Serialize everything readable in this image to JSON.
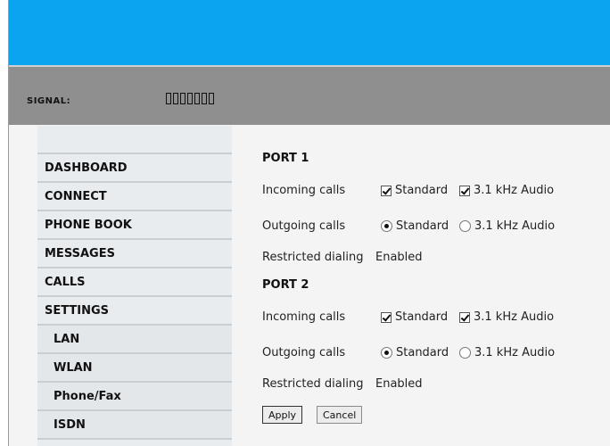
{
  "header": {
    "signal_label": "SIGNAL:",
    "signal_bars_total": 7,
    "signal_bars_filled": 0
  },
  "nav": {
    "items": [
      {
        "label": "DASHBOARD",
        "sub": false
      },
      {
        "label": "CONNECT",
        "sub": false
      },
      {
        "label": "PHONE BOOK",
        "sub": false
      },
      {
        "label": "MESSAGES",
        "sub": false
      },
      {
        "label": "CALLS",
        "sub": false
      },
      {
        "label": "SETTINGS",
        "sub": false
      },
      {
        "label": "LAN",
        "sub": true
      },
      {
        "label": "WLAN",
        "sub": true
      },
      {
        "label": "Phone/Fax",
        "sub": true
      },
      {
        "label": "ISDN",
        "sub": true
      }
    ]
  },
  "port1": {
    "title": "PORT 1",
    "incoming_label": "Incoming calls",
    "incoming_opt1": "Standard",
    "incoming_opt1_checked": true,
    "incoming_opt2": "3.1 kHz Audio",
    "incoming_opt2_checked": true,
    "outgoing_label": "Outgoing calls",
    "outgoing_opt1": "Standard",
    "outgoing_opt2": "3.1 kHz Audio",
    "outgoing_selected": "Standard",
    "restricted_label": "Restricted dialing",
    "restricted_value": "Enabled"
  },
  "port2": {
    "title": "PORT 2",
    "incoming_label": "Incoming calls",
    "incoming_opt1": "Standard",
    "incoming_opt1_checked": true,
    "incoming_opt2": "3.1 kHz Audio",
    "incoming_opt2_checked": true,
    "outgoing_label": "Outgoing calls",
    "outgoing_opt1": "Standard",
    "outgoing_opt2": "3.1 kHz Audio",
    "outgoing_selected": "Standard",
    "restricted_label": "Restricted dialing",
    "restricted_value": "Enabled"
  },
  "actions": {
    "apply": "Apply",
    "cancel": "Cancel"
  },
  "colors": {
    "topbar": "#0aa4f0",
    "signalbar": "#8f8f8f",
    "nav_bg": "#e9ecef"
  }
}
